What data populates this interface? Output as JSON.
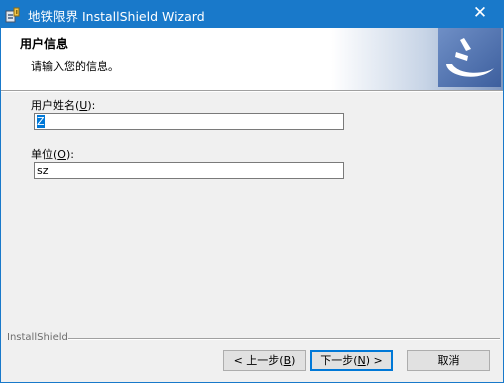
{
  "window": {
    "title": "地铁限界 InstallShield Wizard",
    "close_glyph": "✕"
  },
  "header": {
    "title": "用户信息",
    "subtitle": "请输入您的信息。"
  },
  "form": {
    "username": {
      "label_prefix": "用户姓名(",
      "accel": "U",
      "label_suffix": "):",
      "value": "Z"
    },
    "organization": {
      "label_prefix": "单位(",
      "accel": "O",
      "label_suffix": "):",
      "value": "sz"
    }
  },
  "footer": {
    "brand": "InstallShield"
  },
  "buttons": {
    "back": {
      "prefix": "< 上一步(",
      "accel": "B",
      "suffix": ")"
    },
    "next": {
      "prefix": "下一步(",
      "accel": "N",
      "suffix": ") >"
    },
    "cancel": {
      "label": "取消"
    }
  },
  "colors": {
    "titlebar": "#1979ca",
    "accent": "#0078d7"
  }
}
